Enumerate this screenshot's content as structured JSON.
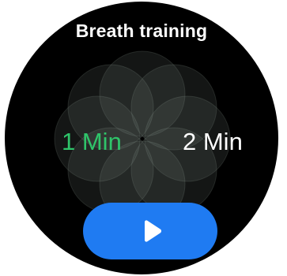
{
  "app": {
    "title": "Breath training"
  },
  "durations": [
    {
      "label": "1 Min",
      "selected": true
    },
    {
      "label": "2 Min",
      "selected": false
    }
  ],
  "colors": {
    "background": "#000000",
    "selected_duration": "#2fc56a",
    "unselected_duration": "#ffffff",
    "play_button": "#1f7bf2",
    "petal_fill": "#7a8a82"
  },
  "icons": {
    "play_button_icon": "play-icon",
    "decoration": "breath-flower-icon"
  }
}
